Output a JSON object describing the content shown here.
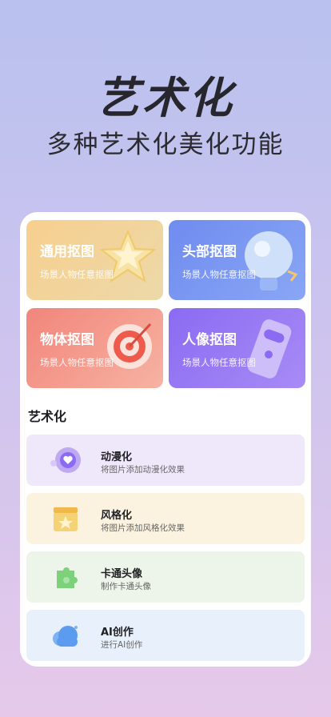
{
  "hero": {
    "title": "艺术化",
    "subtitle": "多种艺术化美化功能"
  },
  "cards": [
    {
      "title": "通用抠图",
      "subtitle": "场景人物任意抠图",
      "icon": "star-icon"
    },
    {
      "title": "头部抠图",
      "subtitle": "场景人物任意抠图",
      "icon": "bulb-icon"
    },
    {
      "title": "物体抠图",
      "subtitle": "场景人物任意抠图",
      "icon": "target-icon"
    },
    {
      "title": "人像抠图",
      "subtitle": "场景人物任意抠图",
      "icon": "phone-icon"
    }
  ],
  "section": {
    "title": "艺术化"
  },
  "list": [
    {
      "title": "动漫化",
      "subtitle": "将图片添加动漫化效果",
      "icon": "heart-icon"
    },
    {
      "title": "风格化",
      "subtitle": "将图片添加风格化效果",
      "icon": "clapper-icon"
    },
    {
      "title": "卡通头像",
      "subtitle": "制作卡通头像",
      "icon": "puzzle-icon"
    },
    {
      "title": "AI创作",
      "subtitle": "进行AI创作",
      "icon": "cloud-icon"
    }
  ]
}
